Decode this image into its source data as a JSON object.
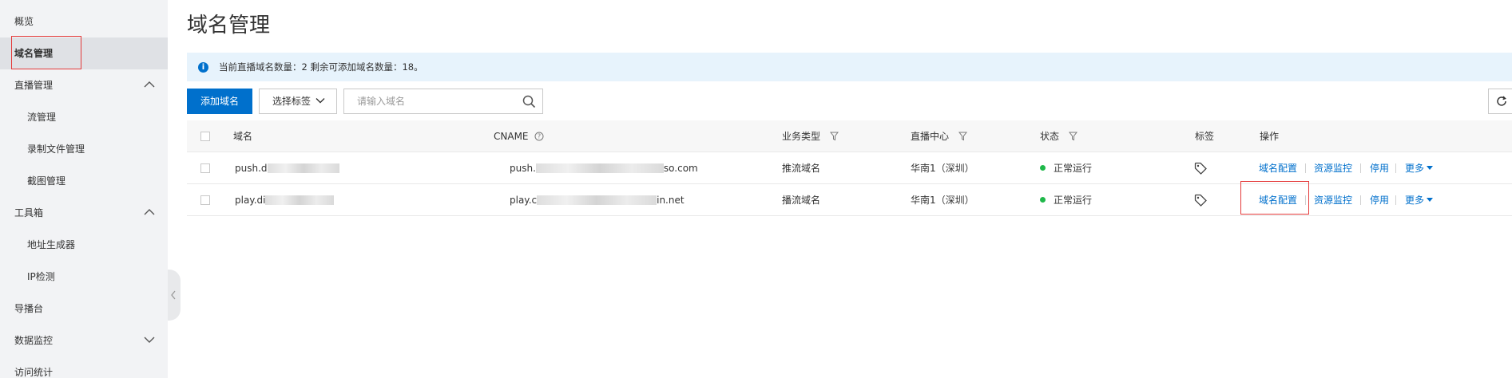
{
  "sidebar": {
    "items": [
      {
        "label": "概览"
      },
      {
        "label": "域名管理"
      },
      {
        "label": "直播管理"
      },
      {
        "label": "流管理"
      },
      {
        "label": "录制文件管理"
      },
      {
        "label": "截图管理"
      },
      {
        "label": "工具箱"
      },
      {
        "label": "地址生成器"
      },
      {
        "label": "IP检测"
      },
      {
        "label": "导播台"
      },
      {
        "label": "数据监控"
      },
      {
        "label": "访问统计"
      }
    ]
  },
  "page": {
    "title": "域名管理",
    "notice": "当前直播域名数量：2 剩余可添加域名数量：18。"
  },
  "toolbar": {
    "add_label": "添加域名",
    "tag_select_label": "选择标签",
    "search_placeholder": "请输入域名"
  },
  "table": {
    "columns": {
      "domain": "域名",
      "cname": "CNAME",
      "biz_type": "业务类型",
      "region": "直播中心",
      "status": "状态",
      "tag": "标签",
      "ops": "操作"
    },
    "rows": [
      {
        "domain_prefix": "push.d",
        "cname_prefix": "push.",
        "cname_suffix": "so.com",
        "biz_type": "推流域名",
        "region": "华南1（深圳）",
        "status": "正常运行"
      },
      {
        "domain_prefix": "play.di",
        "cname_prefix": "play.c",
        "cname_suffix": "in.net",
        "biz_type": "播流域名",
        "region": "华南1（深圳）",
        "status": "正常运行"
      }
    ],
    "actions": {
      "config": "域名配置",
      "monitor": "资源监控",
      "disable": "停用",
      "more": "更多"
    }
  },
  "colors": {
    "primary": "#0070cc",
    "status_ok": "#1fb84a",
    "highlight": "#e43a3a"
  }
}
